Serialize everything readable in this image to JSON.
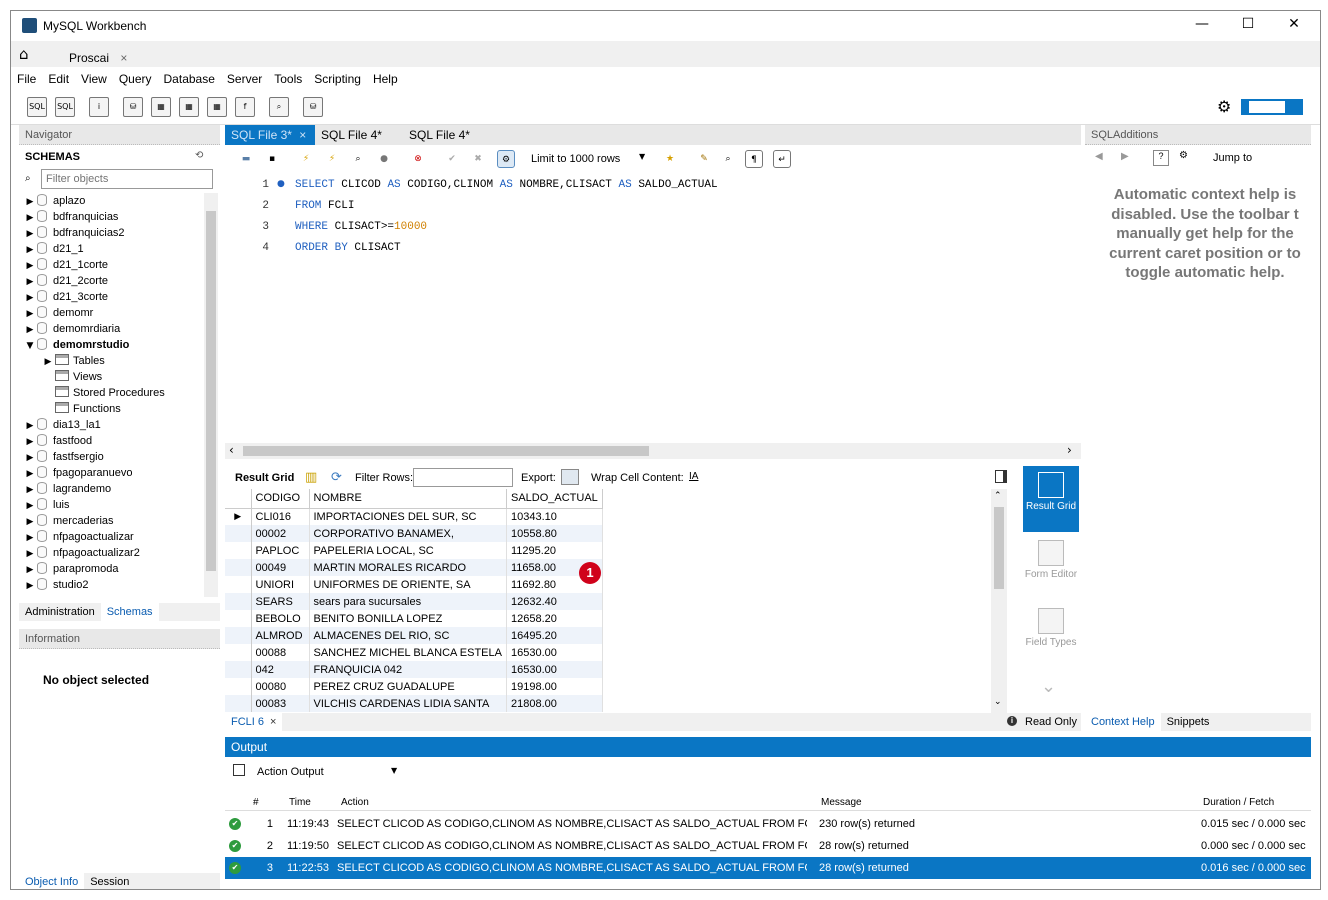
{
  "window": {
    "title": "MySQL Workbench",
    "minimize": "—",
    "maximize": "☐",
    "close": "✕"
  },
  "connection_tab": {
    "label": "Proscai",
    "close": "×"
  },
  "menu": [
    "File",
    "Edit",
    "View",
    "Query",
    "Database",
    "Server",
    "Tools",
    "Scripting",
    "Help"
  ],
  "navigator": {
    "header": "Navigator",
    "schemas_label": "SCHEMAS",
    "filter_placeholder": "Filter objects",
    "schemas": [
      {
        "name": "aplazo",
        "expanded": false
      },
      {
        "name": "bdfranquicias",
        "expanded": false
      },
      {
        "name": "bdfranquicias2",
        "expanded": false
      },
      {
        "name": "d21_1",
        "expanded": false
      },
      {
        "name": "d21_1corte",
        "expanded": false
      },
      {
        "name": "d21_2corte",
        "expanded": false
      },
      {
        "name": "d21_3corte",
        "expanded": false
      },
      {
        "name": "demomr",
        "expanded": false
      },
      {
        "name": "demomrdiaria",
        "expanded": false
      },
      {
        "name": "demomrstudio",
        "expanded": true
      },
      {
        "name": "Tables",
        "child": true,
        "arrow": true
      },
      {
        "name": "Views",
        "child": true
      },
      {
        "name": "Stored Procedures",
        "child": true
      },
      {
        "name": "Functions",
        "child": true
      },
      {
        "name": "dia13_la1",
        "expanded": false
      },
      {
        "name": "fastfood",
        "expanded": false
      },
      {
        "name": "fastfsergio",
        "expanded": false
      },
      {
        "name": "fpagoparanuevo",
        "expanded": false
      },
      {
        "name": "lagrandemo",
        "expanded": false
      },
      {
        "name": "luis",
        "expanded": false
      },
      {
        "name": "mercaderias",
        "expanded": false
      },
      {
        "name": "nfpagoactualizar",
        "expanded": false
      },
      {
        "name": "nfpagoactualizar2",
        "expanded": false
      },
      {
        "name": "parapromoda",
        "expanded": false
      },
      {
        "name": "studio2",
        "expanded": false
      }
    ],
    "tabs": [
      "Administration",
      "Schemas"
    ],
    "info_header": "Information",
    "no_object": "No object selected",
    "bottom_tabs": [
      "Object Info",
      "Session"
    ]
  },
  "editor": {
    "tabs": [
      {
        "label": "SQL File 3*",
        "active": true,
        "close": "×"
      },
      {
        "label": "SQL File 4*"
      },
      {
        "label": "SQL File 4*"
      }
    ],
    "limit_label": "Limit to 1000 rows",
    "lines": [
      {
        "n": "1",
        "tokens": [
          [
            "kw",
            "SELECT "
          ],
          [
            "",
            "CLICOD "
          ],
          [
            "kw",
            "AS "
          ],
          [
            "",
            "CODIGO,CLINOM "
          ],
          [
            "kw",
            "AS "
          ],
          [
            "",
            "NOMBRE,CLISACT "
          ],
          [
            "kw",
            "AS "
          ],
          [
            "",
            "SALDO_ACTUAL"
          ]
        ]
      },
      {
        "n": "2",
        "tokens": [
          [
            "kw",
            "FROM "
          ],
          [
            "",
            "FCLI"
          ]
        ]
      },
      {
        "n": "3",
        "tokens": [
          [
            "kw",
            "WHERE "
          ],
          [
            "",
            "CLISACT>="
          ],
          [
            "num",
            "10000"
          ]
        ]
      },
      {
        "n": "4",
        "tokens": [
          [
            "kw",
            "ORDER BY "
          ],
          [
            "",
            "CLISACT"
          ]
        ]
      }
    ]
  },
  "result": {
    "tab_label": "Result Grid",
    "filter_label": "Filter Rows:",
    "export_label": "Export:",
    "wrap_label": "Wrap Cell Content:",
    "columns": [
      "CODIGO",
      "NOMBRE",
      "SALDO_ACTUAL"
    ],
    "rows": [
      [
        "CLI016",
        "IMPORTACIONES DEL SUR, SC",
        "10343.10"
      ],
      [
        "00002",
        "CORPORATIVO BANAMEX,",
        "10558.80"
      ],
      [
        "PAPLOC",
        "PAPELERIA LOCAL,  SC",
        "11295.20"
      ],
      [
        "00049",
        "MARTIN MORALES RICARDO",
        "11658.00"
      ],
      [
        "UNIORI",
        "UNIFORMES DE ORIENTE, SA",
        "11692.80"
      ],
      [
        "SEARS",
        "sears para sucursales",
        "12632.40"
      ],
      [
        "BEBOLO",
        "BENITO BONILLA LOPEZ",
        "12658.20"
      ],
      [
        "ALMROD",
        "ALMACENES DEL RIO, SC",
        "16495.20"
      ],
      [
        "00088",
        "SANCHEZ MICHEL BLANCA ESTELA",
        "16530.00"
      ],
      [
        "042",
        "FRANQUICIA 042",
        "16530.00"
      ],
      [
        "00080",
        "PEREZ CRUZ GUADALUPE",
        "19198.00"
      ],
      [
        "00083",
        "VILCHIS CARDENAS LIDIA SANTA",
        "21808.00"
      ]
    ],
    "result_tab": "FCLI 6",
    "read_only": "Read Only",
    "side_buttons": [
      {
        "label": "Result Grid",
        "active": true
      },
      {
        "label": "Form Editor"
      },
      {
        "label": "Field Types"
      }
    ],
    "badge": "1"
  },
  "sql_additions": {
    "header": "SQLAdditions",
    "jump_label": "Jump to",
    "help_lines": [
      "Automatic context help is",
      "disabled. Use the toolbar t",
      "manually get help for the",
      "current caret position or to",
      "toggle automatic help."
    ],
    "tabs": [
      "Context Help",
      "Snippets"
    ]
  },
  "output": {
    "header": "Output",
    "selector": "Action Output",
    "columns": {
      "num": "#",
      "time": "Time",
      "action": "Action",
      "message": "Message",
      "duration": "Duration / Fetch"
    },
    "rows": [
      {
        "num": "1",
        "time": "11:19:43",
        "action": "SELECT CLICOD AS CODIGO,CLINOM AS NOMBRE,CLISACT AS SALDO_ACTUAL FROM FCL...",
        "message": "230 row(s) returned",
        "duration": "0.015 sec / 0.000 sec"
      },
      {
        "num": "2",
        "time": "11:19:50",
        "action": "SELECT CLICOD AS CODIGO,CLINOM AS NOMBRE,CLISACT AS SALDO_ACTUAL FROM FCL...",
        "message": "28 row(s) returned",
        "duration": "0.000 sec / 0.000 sec"
      },
      {
        "num": "3",
        "time": "11:22:53",
        "action": "SELECT CLICOD AS CODIGO,CLINOM AS NOMBRE,CLISACT AS SALDO_ACTUAL FROM FCL...",
        "message": "28 row(s) returned",
        "duration": "0.016 sec / 0.000 sec",
        "selected": true
      }
    ]
  }
}
